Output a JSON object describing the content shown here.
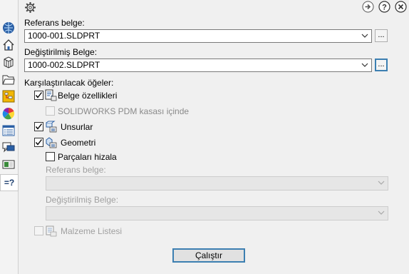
{
  "left_tabs": [
    {
      "name": "globe-icon"
    },
    {
      "name": "house-icon"
    },
    {
      "name": "box-icon"
    },
    {
      "name": "folder-icon"
    },
    {
      "name": "tree-icon"
    },
    {
      "name": "color-wheel-icon"
    },
    {
      "name": "list-icon"
    },
    {
      "name": "chat-icon"
    },
    {
      "name": "monitor-icon"
    },
    {
      "name": "compare-icon",
      "label": "=?"
    }
  ],
  "header": {
    "settings_icon": "gear-icon",
    "forward_icon": "arrow-right-icon",
    "help_icon": "help-icon",
    "close_icon": "close-icon"
  },
  "reference": {
    "label": "Referans belge:",
    "value": "1000-001.SLDPRT",
    "browse": "..."
  },
  "modified": {
    "label": "Değiştirilmiş Belge:",
    "value": "1000-002.SLDPRT",
    "browse": "..."
  },
  "compare_items_label": "Karşılaştırılacak öğeler:",
  "items": {
    "doc_props": {
      "label": "Belge özellikleri",
      "checked": true
    },
    "pdm": {
      "label": "SOLIDWORKS PDM kasası içinde",
      "checked": false,
      "disabled": true
    },
    "features": {
      "label": "Unsurlar",
      "checked": true
    },
    "geometry": {
      "label": "Geometri",
      "checked": true
    },
    "align": {
      "label": "Parçaları hizala",
      "checked": false
    },
    "ref_config": {
      "label": "Referans belge:",
      "value": ""
    },
    "mod_config": {
      "label": "Değiştirilmiş Belge:",
      "value": ""
    },
    "bom": {
      "label": "Malzeme Listesi",
      "checked": false,
      "disabled": true
    }
  },
  "run_label": "Çalıştır"
}
